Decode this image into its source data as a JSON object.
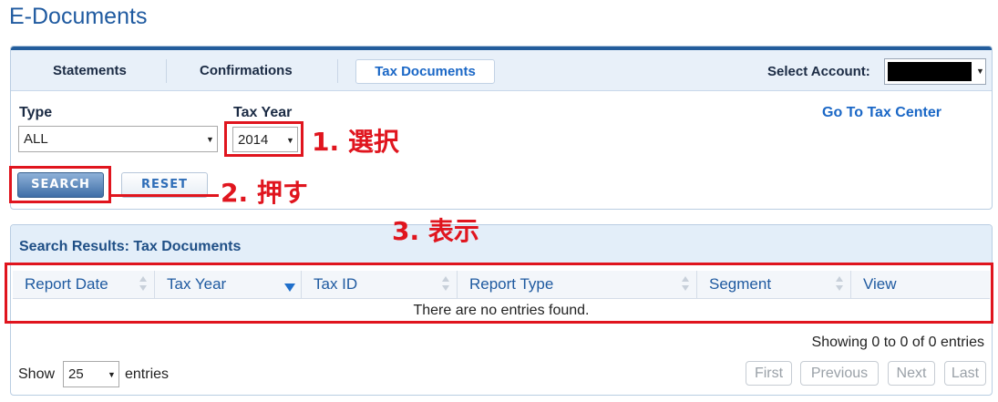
{
  "page": {
    "title": "E-Documents"
  },
  "tabs": {
    "statements": "Statements",
    "confirmations": "Confirmations",
    "tax_documents": "Tax Documents",
    "select_account_label": "Select Account:"
  },
  "filters": {
    "type_label": "Type",
    "type_value": "ALL",
    "tax_year_label": "Tax Year",
    "tax_year_value": "2014",
    "go_to_tax_center": "Go To Tax Center",
    "search_button": "SEARCH",
    "reset_button": "RESET"
  },
  "results": {
    "title": "Search Results: Tax Documents",
    "columns": [
      "Report Date",
      "Tax Year",
      "Tax ID",
      "Report Type",
      "Segment",
      "View"
    ],
    "sorted_column": "Tax Year",
    "empty_message": "There are no entries found.",
    "showing": "Showing 0 to 0 of 0 entries",
    "show_label": "Show",
    "page_size": "25",
    "entries_label": "entries",
    "pagination": [
      "First",
      "Previous",
      "Next",
      "Last"
    ]
  },
  "annotations": {
    "step1": "1. 選択",
    "step2": "2. 押す",
    "step3": "3. 表示",
    "color": "#e0151e"
  },
  "colors": {
    "brand_blue": "#1f5aa0",
    "link_blue": "#1a67c6",
    "header_bar": "#235d9c"
  }
}
